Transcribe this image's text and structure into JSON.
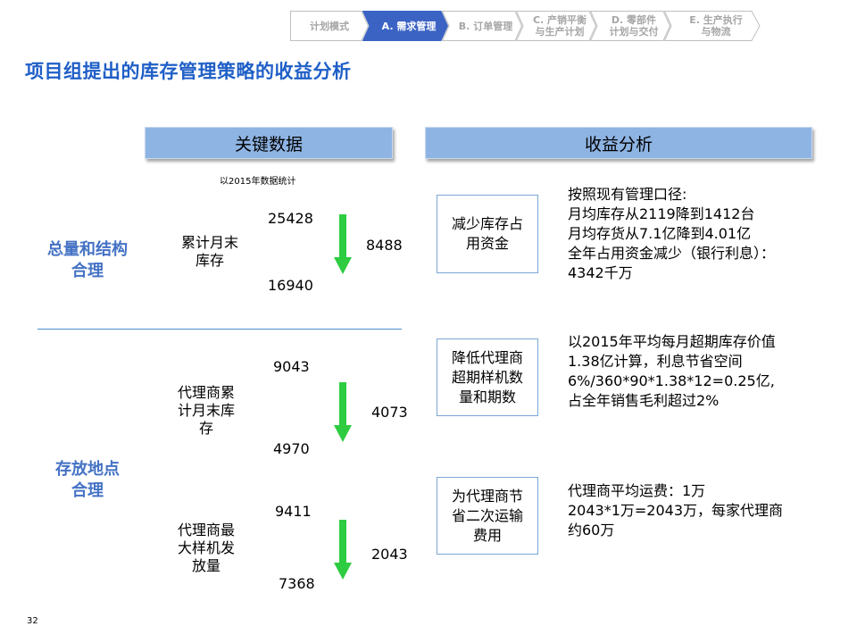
{
  "breadcrumb": [
    {
      "label": "计划模式",
      "active": false
    },
    {
      "label": "A. 需求管理",
      "active": true
    },
    {
      "label": "B. 订单管理",
      "active": false
    },
    {
      "label": "C. 产销平衡\n与生产计划",
      "active": false
    },
    {
      "label": "D. 零部件\n计划与交付",
      "active": false
    },
    {
      "label": "E. 生产执行\n与物流",
      "active": false
    }
  ],
  "title": "项目组提出的库存管理策略的收益分析",
  "headers": {
    "left": "关键数据",
    "right": "收益分析"
  },
  "note": "以2015年数据统计",
  "categories": [
    "总量和结构\n合理",
    "存放地点\n合理"
  ],
  "metrics": [
    {
      "label": "累计月末\n库存",
      "before": "25428",
      "after": "16940",
      "diff": "8488"
    },
    {
      "label": "代理商累\n计月末库\n存",
      "before": "9043",
      "after": "4970",
      "diff": "4073"
    },
    {
      "label": "代理商最\n大样机发\n放量",
      "before": "9411",
      "after": "7368",
      "diff": "2043"
    }
  ],
  "benefits": [
    {
      "box": "减少库存占\n用资金",
      "lines": [
        "按照现有管理口径:",
        "月均库存从2119降到1412台",
        "月均存货从7.1亿降到4.01亿",
        "全年占用资金减少（银行利息）：",
        "4342千万"
      ]
    },
    {
      "box": "降低代理商\n超期样机数\n量和期数",
      "lines": [
        "以2015年平均每月超期库存价值",
        "1.38亿计算，利息节省空间",
        "6%/360*90*1.38*12=0.25亿,",
        "占全年销售毛利超过2%"
      ]
    },
    {
      "box": "为代理商节\n省二次运输\n费用",
      "lines": [
        "代理商平均运费：1万",
        "2043*1万=2043万，每家代理商",
        "约60万"
      ]
    }
  ],
  "page_number": "32",
  "colors": {
    "title": "#1f5fc7",
    "header_bg": "#8eb4e3",
    "arrow": "#2ecc40",
    "active_crumb": "#3b63c4"
  }
}
